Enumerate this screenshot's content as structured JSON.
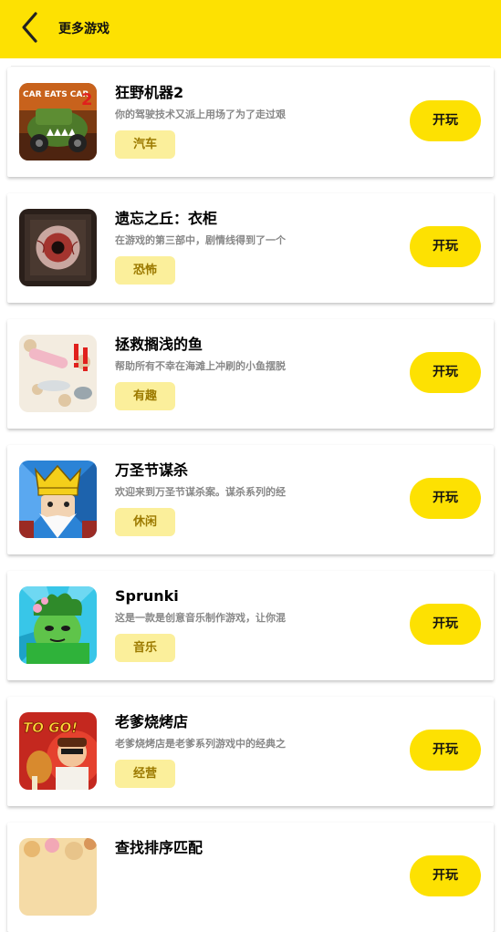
{
  "header": {
    "title": "更多游戏"
  },
  "colors": {
    "accent": "#fde102",
    "tag_bg": "#fbef9b",
    "tag_text": "#9c7a00",
    "desc_text": "#888888"
  },
  "games": [
    {
      "title": "狂野机器2",
      "desc": "你的驾驶技术又派上用场了为了走过艰",
      "tag": "汽车",
      "play_label": "开玩",
      "thumb_icon": "car-eats-car-thumbnail"
    },
    {
      "title": "遗忘之丘：衣柜",
      "desc": "在游戏的第三部中，剧情线得到了一个",
      "tag": "恐怖",
      "play_label": "开玩",
      "thumb_icon": "eyeball-thumbnail"
    },
    {
      "title": "拯救搁浅的鱼",
      "desc": "帮助所有不幸在海滩上冲刷的小鱼摆脱",
      "tag": "有趣",
      "play_label": "开玩",
      "thumb_icon": "stranded-fish-thumbnail"
    },
    {
      "title": "万圣节谋杀",
      "desc": "欢迎来到万圣节谋杀案。谋杀系列的经",
      "tag": "休闲",
      "play_label": "开玩",
      "thumb_icon": "king-thumbnail"
    },
    {
      "title": "Sprunki",
      "desc": "这是一款是创意音乐制作游戏，让你混",
      "tag": "音乐",
      "play_label": "开玩",
      "thumb_icon": "sprunki-thumbnail"
    },
    {
      "title": "老爹烧烤店",
      "desc": "老爹烧烤店是老爹系列游戏中的经典之",
      "tag": "经营",
      "play_label": "开玩",
      "thumb_icon": "papa-togo-thumbnail"
    },
    {
      "title": "查找排序匹配",
      "desc": "",
      "tag": "",
      "play_label": "开玩",
      "thumb_icon": "sort-match-thumbnail"
    }
  ]
}
